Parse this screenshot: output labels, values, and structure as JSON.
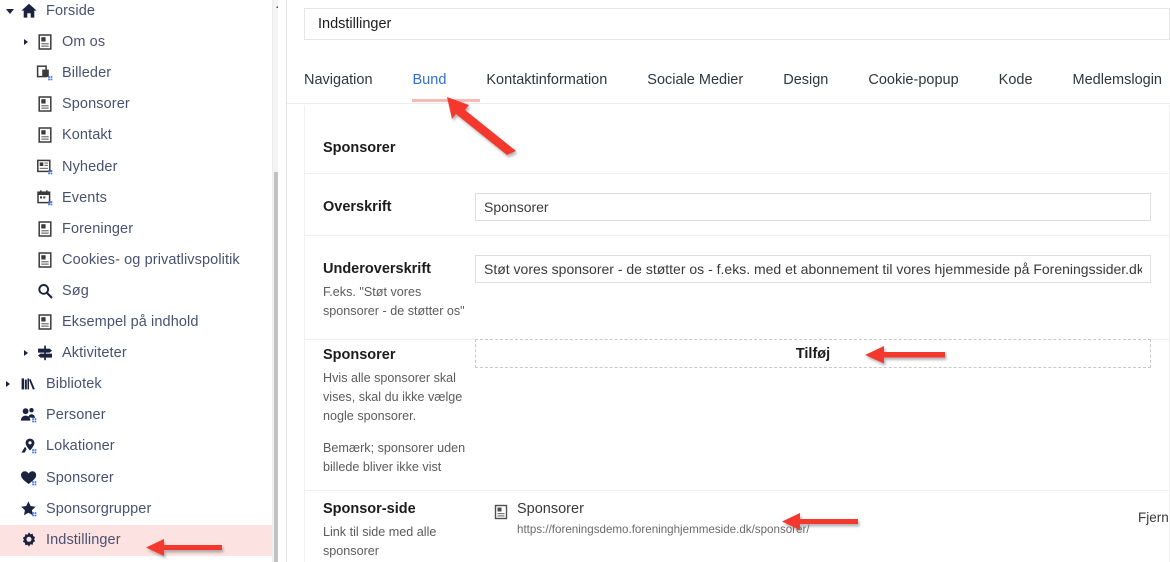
{
  "sidebar": {
    "scroll": {
      "thumb_visible": true
    },
    "items": [
      {
        "label": "Forside",
        "icon": "home-icon",
        "indent": 0,
        "caret": "down",
        "active": false
      },
      {
        "label": "Om os",
        "icon": "page-icon",
        "indent": 1,
        "caret": "right",
        "active": false
      },
      {
        "label": "Billeder",
        "icon": "images-icon",
        "indent": 1,
        "caret": "none",
        "active": false
      },
      {
        "label": "Sponsorer",
        "icon": "page-icon",
        "indent": 1,
        "caret": "none",
        "active": false
      },
      {
        "label": "Kontakt",
        "icon": "page-icon",
        "indent": 1,
        "caret": "none",
        "active": false
      },
      {
        "label": "Nyheder",
        "icon": "news-icon",
        "indent": 1,
        "caret": "none",
        "active": false
      },
      {
        "label": "Events",
        "icon": "calendar-icon",
        "indent": 1,
        "caret": "none",
        "active": false
      },
      {
        "label": "Foreninger",
        "icon": "page-icon",
        "indent": 1,
        "caret": "none",
        "active": false
      },
      {
        "label": "Cookies- og privatlivspolitik",
        "icon": "page-icon",
        "indent": 1,
        "caret": "none",
        "active": false
      },
      {
        "label": "Søg",
        "icon": "search-icon",
        "indent": 1,
        "caret": "none",
        "active": false
      },
      {
        "label": "Eksempel på indhold",
        "icon": "page-icon",
        "indent": 1,
        "caret": "none",
        "active": false
      },
      {
        "label": "Aktiviteter",
        "icon": "signpost-icon",
        "indent": 1,
        "caret": "right",
        "active": false
      },
      {
        "label": "Bibliotek",
        "icon": "books-icon",
        "indent": 0,
        "caret": "right",
        "active": false
      },
      {
        "label": "Personer",
        "icon": "people-icon",
        "indent": 0,
        "caret": "none",
        "active": false
      },
      {
        "label": "Lokationer",
        "icon": "location-icon",
        "indent": 0,
        "caret": "none",
        "active": false
      },
      {
        "label": "Sponsorer",
        "icon": "heart-icon",
        "indent": 0,
        "caret": "none",
        "active": false
      },
      {
        "label": "Sponsorgrupper",
        "icon": "star-icon",
        "indent": 0,
        "caret": "none",
        "active": false
      },
      {
        "label": "Indstillinger",
        "icon": "gear-icon",
        "indent": 0,
        "caret": "none",
        "active": true
      }
    ]
  },
  "header": {
    "title": "Indstillinger"
  },
  "tabs": [
    {
      "label": "Navigation",
      "active": false
    },
    {
      "label": "Bund",
      "active": true
    },
    {
      "label": "Kontaktinformation",
      "active": false
    },
    {
      "label": "Sociale Medier",
      "active": false
    },
    {
      "label": "Design",
      "active": false
    },
    {
      "label": "Cookie-popup",
      "active": false
    },
    {
      "label": "Kode",
      "active": false
    },
    {
      "label": "Medlemslogin",
      "active": false
    }
  ],
  "panel": {
    "section_title": "Sponsorer",
    "fields": {
      "overskrift": {
        "label": "Overskrift",
        "value": "Sponsorer",
        "placeholder": ""
      },
      "underoverskrift": {
        "label": "Underoverskrift",
        "help": "F.eks. \"Støt vores sponsorer - de støtter os\"",
        "value": "Støt vores sponsorer - de støtter os - f.eks. med et abonnement til vores hjemmeside på Foreningssider.dk",
        "placeholder": ""
      },
      "sponsorer": {
        "label": "Sponsorer",
        "help_1": "Hvis alle sponsorer skal vises, skal du ikke vælge nogle sponsorer.",
        "help_2": "Bemærk; sponsorer uden billede bliver ikke vist",
        "add_label": "Tilføj"
      },
      "sponsor_side": {
        "label": "Sponsor-side",
        "help": "Link til side med alle sponsorer",
        "link_title": "Sponsorer",
        "link_url": "https://foreningsdemo.foreninghjemmeside.dk/sponsorer/",
        "remove_label": "Fjern"
      }
    }
  },
  "annotations": {
    "arrow_color": "#f4372e",
    "highlight_color": "#fce3e1",
    "tab_underline_color": "#f6b9b4",
    "arrows": [
      {
        "name": "arrow-to-indstillinger",
        "target": "Indstillinger"
      },
      {
        "name": "arrow-to-bund-tab",
        "target": "Bund"
      },
      {
        "name": "arrow-to-tilfoj",
        "target": "Tilføj"
      },
      {
        "name": "arrow-to-sponsor-url",
        "target": "link_url"
      }
    ]
  }
}
